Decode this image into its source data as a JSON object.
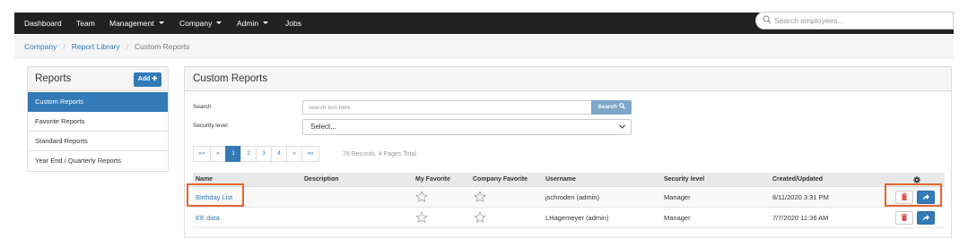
{
  "nav": {
    "items": [
      {
        "label": "Dashboard",
        "dropdown": false
      },
      {
        "label": "Team",
        "dropdown": false
      },
      {
        "label": "Management",
        "dropdown": true
      },
      {
        "label": "Company",
        "dropdown": true
      },
      {
        "label": "Admin",
        "dropdown": true
      },
      {
        "label": "Jobs",
        "dropdown": false
      }
    ],
    "search_placeholder": "Search employees..."
  },
  "breadcrumb": {
    "items": [
      "Company",
      "Report Library"
    ],
    "current": "Custom Reports"
  },
  "sidebar": {
    "title": "Reports",
    "add_label": "Add",
    "items": [
      {
        "label": "Custom Reports",
        "active": true
      },
      {
        "label": "Favorite Reports",
        "active": false
      },
      {
        "label": "Standard Reports",
        "active": false
      },
      {
        "label": "Year End / Quarterly Reports",
        "active": false
      }
    ]
  },
  "main": {
    "title": "Custom Reports",
    "search_label": "Search",
    "search_placeholder": "search text here",
    "search_button": "Search",
    "security_label": "Security level",
    "security_selected": "Select...",
    "pagination": {
      "buttons": [
        "««",
        "«",
        "1",
        "2",
        "3",
        "4",
        "»",
        "»»"
      ],
      "active_page": "1",
      "records_text": "76 Records, 4 Pages Total"
    },
    "table": {
      "columns": [
        "Name",
        "Description",
        "My Favorite",
        "Company Favorite",
        "Username",
        "Security level",
        "Created/Updated"
      ],
      "rows": [
        {
          "name": "Birthday List",
          "description": "",
          "username": "jschroden (admin)",
          "security": "Manager",
          "updated": "8/11/2020 3:31 PM",
          "highlighted": true
        },
        {
          "name": "EE data",
          "description": "",
          "username": "LHagemeyer (admin)",
          "security": "Manager",
          "updated": "7/7/2020 11:36 AM",
          "highlighted": false
        }
      ]
    }
  },
  "colors": {
    "nav_bg": "#222222",
    "primary": "#337ab7",
    "highlight": "#e8642c",
    "delete_icon": "#d9534f"
  },
  "icons": {
    "search": "search-icon",
    "settings": "gear-icon",
    "favorite": "star-outline-icon",
    "delete": "trash-icon",
    "share": "share-arrow-icon"
  }
}
